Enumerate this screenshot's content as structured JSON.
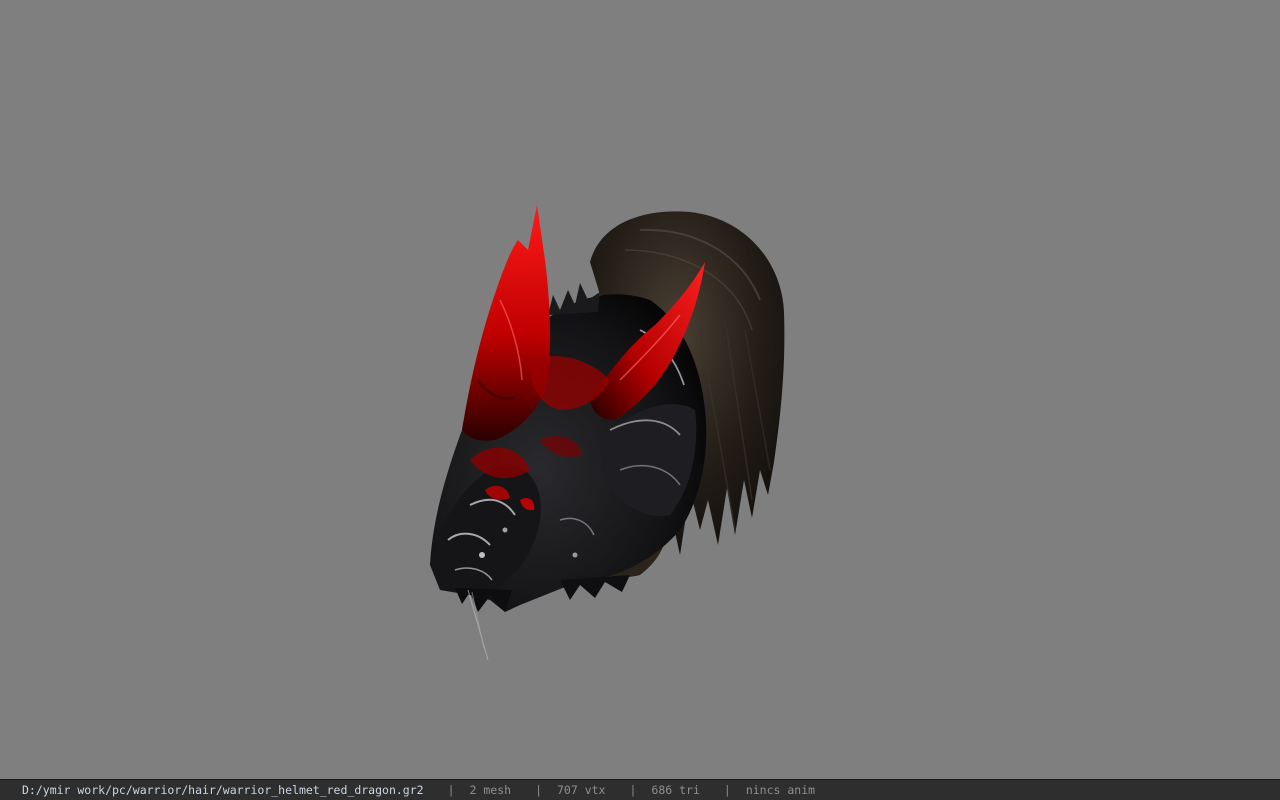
{
  "viewport": {
    "background_color": "#7f7f7f",
    "model_name": "warrior_helmet_red_dragon"
  },
  "status_bar": {
    "file_path": "D:/ymir work/pc/warrior/hair/warrior_helmet_red_dragon.gr2",
    "separator": "|",
    "mesh_count": "2 mesh",
    "vertex_count": "707 vtx",
    "triangle_count": "686 tri",
    "animation_status": "nincs anim",
    "background_color": "#2e2e2e",
    "path_color": "#c9d6e6"
  }
}
